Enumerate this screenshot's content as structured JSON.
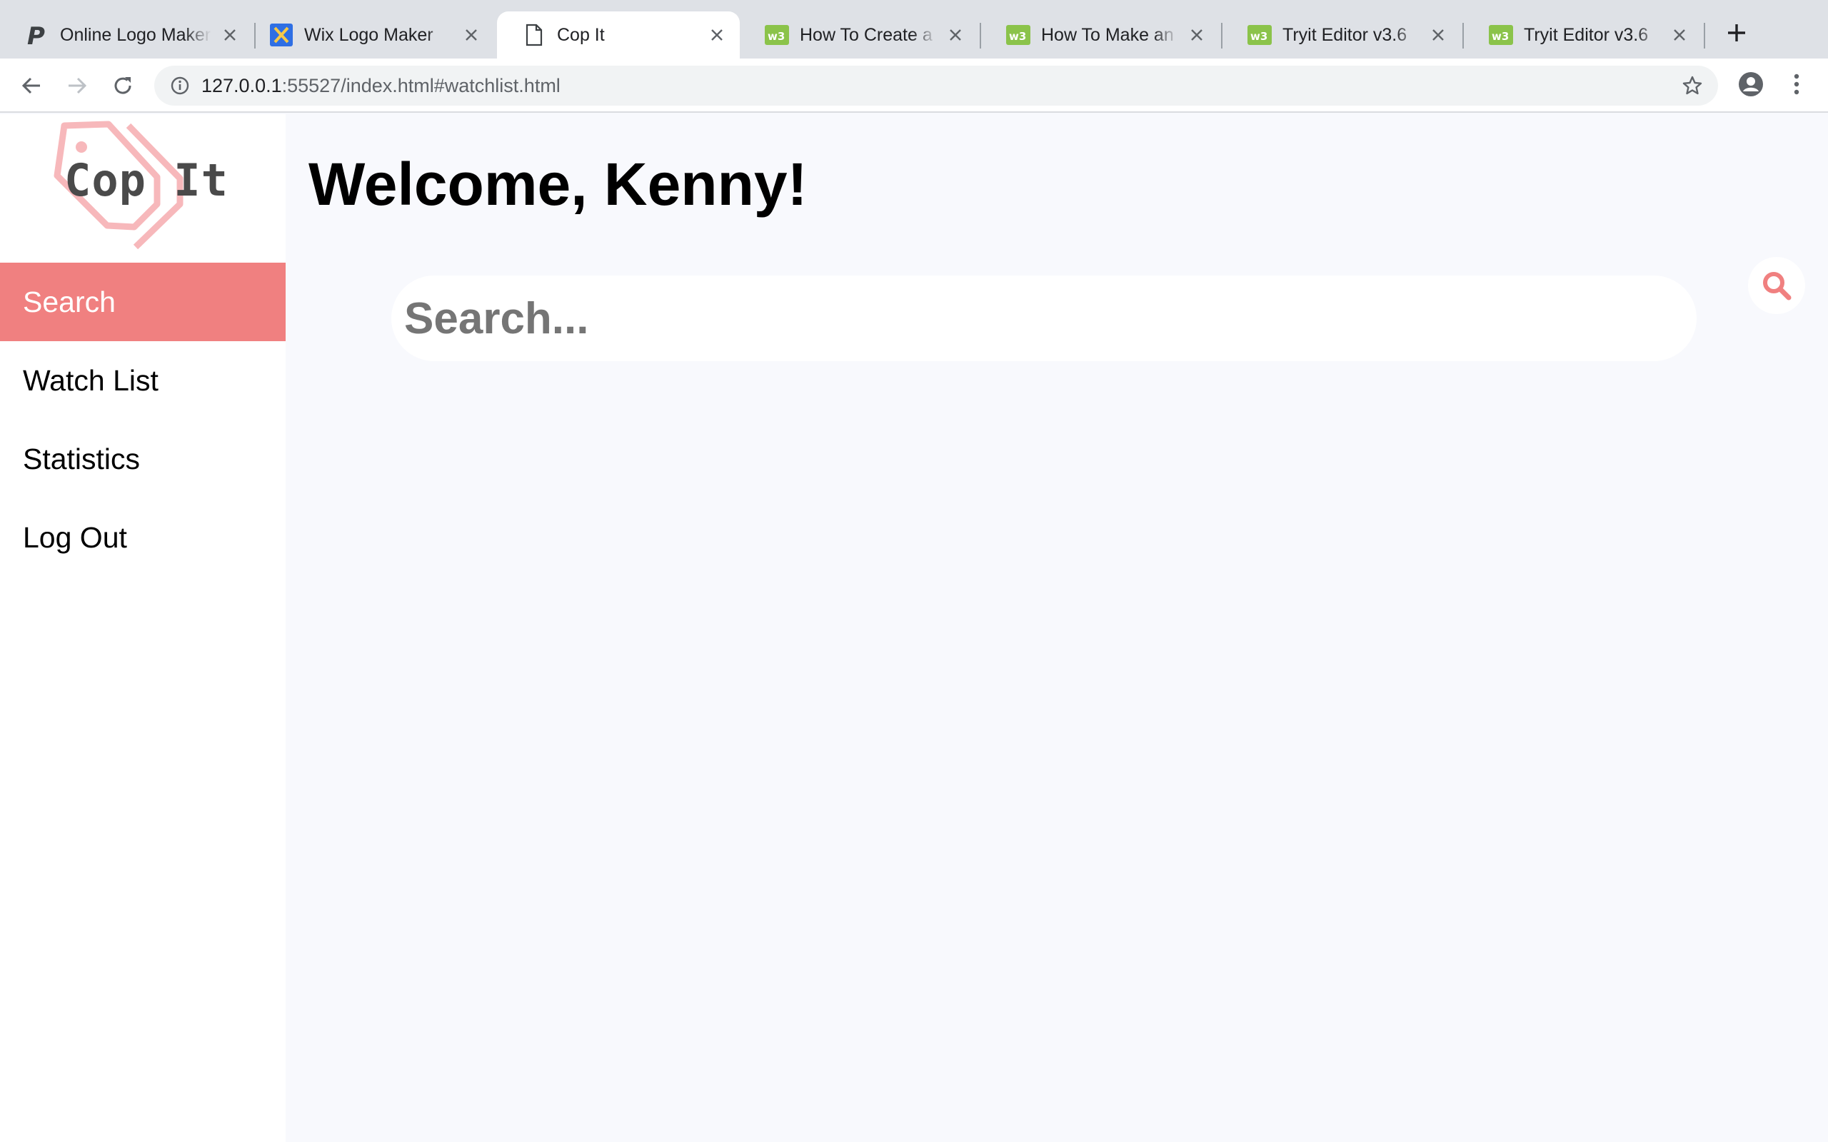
{
  "browser": {
    "tabs": [
      {
        "title": "Online Logo Maker",
        "icon": "pixlr-p-icon",
        "active": false
      },
      {
        "title": "Wix Logo Maker",
        "icon": "wix-icon",
        "active": false
      },
      {
        "title": "Cop It",
        "icon": "page-icon",
        "active": true
      },
      {
        "title": "How To Create a Logo",
        "icon": "w3schools-icon",
        "active": false
      },
      {
        "title": "How To Make an Animated",
        "icon": "w3schools-icon",
        "active": false
      },
      {
        "title": "Tryit Editor v3.6",
        "icon": "w3schools-icon",
        "active": false
      },
      {
        "title": "Tryit Editor v3.6",
        "icon": "w3schools-icon",
        "active": false
      }
    ],
    "url_host": "127.0.0.1",
    "url_rest": ":55527/index.html#watchlist.html"
  },
  "sidebar": {
    "logo_text": "Cop It",
    "items": [
      {
        "label": "Search",
        "active": true
      },
      {
        "label": "Watch List",
        "active": false
      },
      {
        "label": "Statistics",
        "active": false
      },
      {
        "label": "Log Out",
        "active": false
      }
    ]
  },
  "main": {
    "welcome": "Welcome, Kenny!",
    "search_placeholder": "Search..."
  },
  "colors": {
    "accent": "#f08080",
    "logo_tag": "#f7b8bb",
    "page_bg": "#f8f9fd",
    "w3_green": "#8bc34a"
  }
}
